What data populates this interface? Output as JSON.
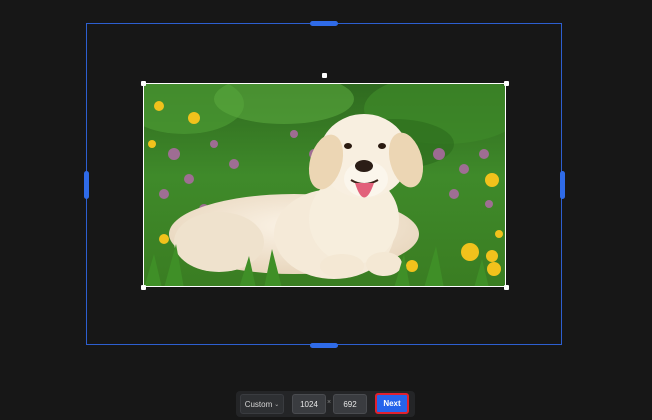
{
  "editor": {
    "image": {
      "description_icon": "photo-dog-icon"
    }
  },
  "toolbar": {
    "preset_label": "Custom",
    "preset_chevron": "⌄",
    "width_value": "1024",
    "dimension_separator": "×",
    "height_value": "692",
    "next_label": "Next"
  },
  "colors": {
    "background": "#171717",
    "frame_border": "#2d5fd0",
    "handle": "#2f6be8",
    "next_button": "#2563eb",
    "highlight_outline": "#e0212f"
  }
}
